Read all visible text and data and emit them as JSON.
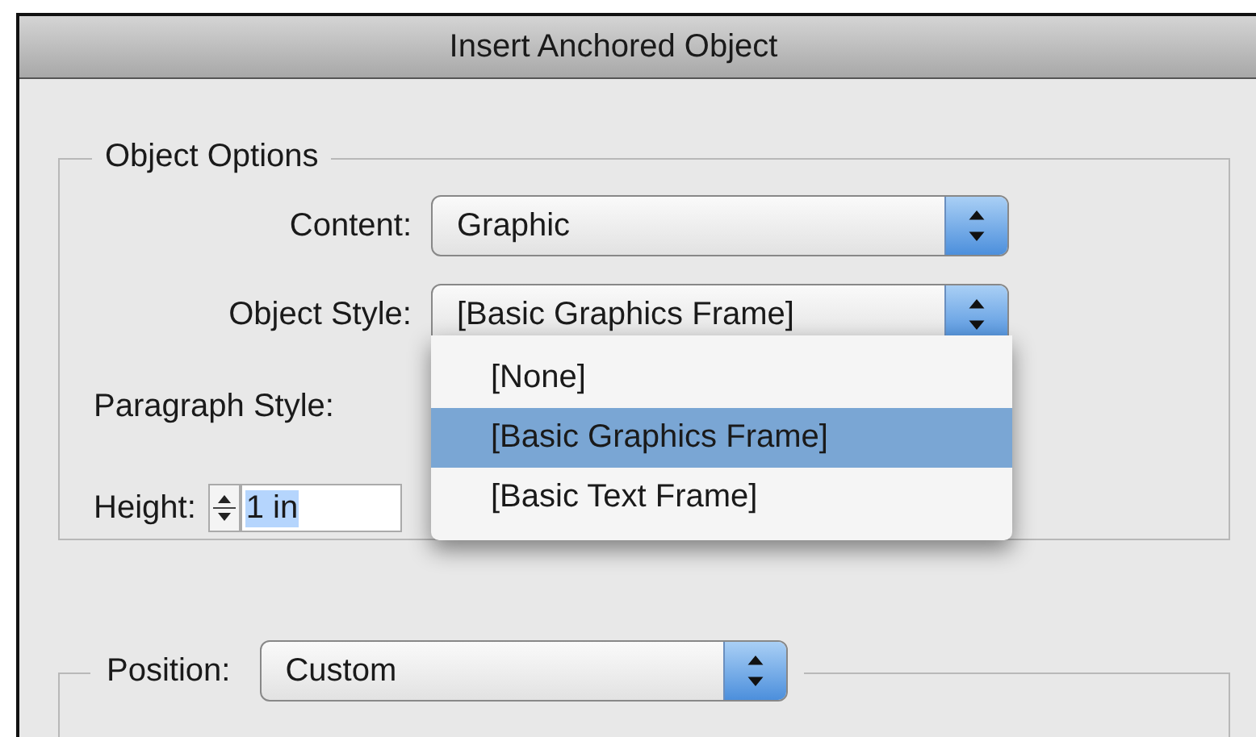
{
  "window": {
    "title": "Insert Anchored Object"
  },
  "object_options": {
    "legend": "Object Options",
    "content": {
      "label": "Content:",
      "value": "Graphic"
    },
    "object_style": {
      "label": "Object Style:",
      "value": "[Basic Graphics Frame]",
      "menu": [
        {
          "label": "[None]",
          "selected": false
        },
        {
          "label": "[Basic Graphics Frame]",
          "selected": true
        },
        {
          "label": "[Basic Text Frame]",
          "selected": false
        }
      ]
    },
    "paragraph_style": {
      "label": "Paragraph Style:"
    },
    "height": {
      "label": "Height:",
      "value": "1 in"
    }
  },
  "position": {
    "label": "Position:",
    "value": "Custom"
  }
}
